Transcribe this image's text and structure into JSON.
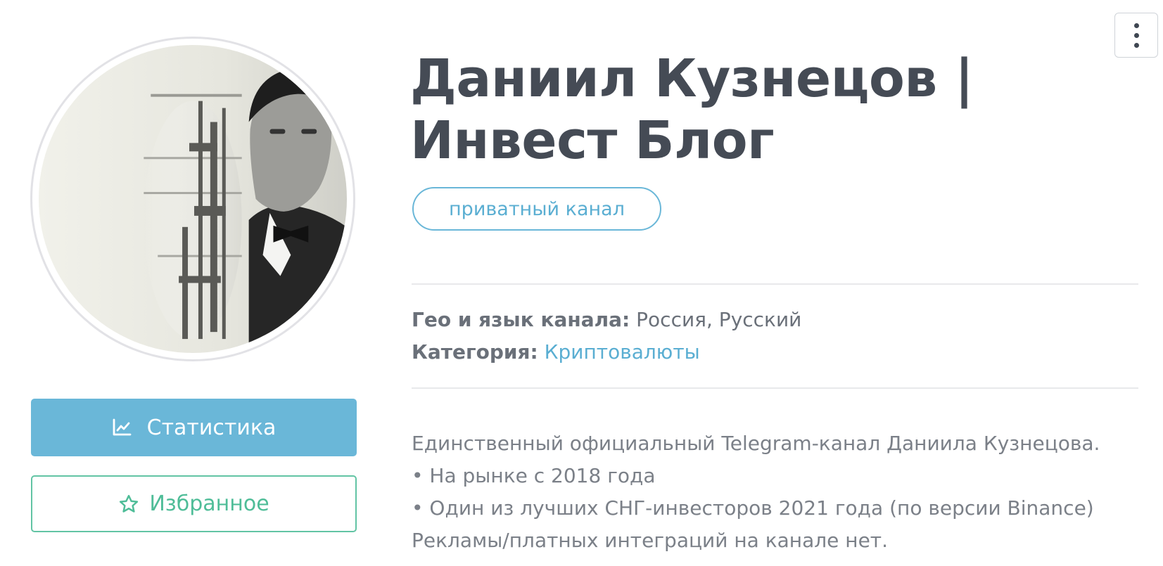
{
  "channel": {
    "title": "Даниил Кузнецов | Инвест Блог",
    "badge": "приватный канал"
  },
  "meta": {
    "geo_label": "Гео и язык канала:",
    "geo_value": "Россия, Русский",
    "category_label": "Категория:",
    "category_value": "Криптовалюты"
  },
  "actions": {
    "stats_label": "Статистика",
    "stats_icon": "chart-line-icon",
    "favorite_label": "Избранное",
    "favorite_icon": "star-outline-icon",
    "menu_icon": "kebab-menu-icon"
  },
  "description": [
    "Единственный официальный Telegram-канал Даниила Кузнецова.",
    "• На рынке с 2018 года",
    "• Один из лучших СНГ-инвесторов 2021 года (по версии Binance)",
    "Рекламы/платных интеграций на канале нет."
  ],
  "colors": {
    "accent_blue": "#6ab7d8",
    "accent_green": "#4fbd98",
    "title_text": "#454b55"
  }
}
